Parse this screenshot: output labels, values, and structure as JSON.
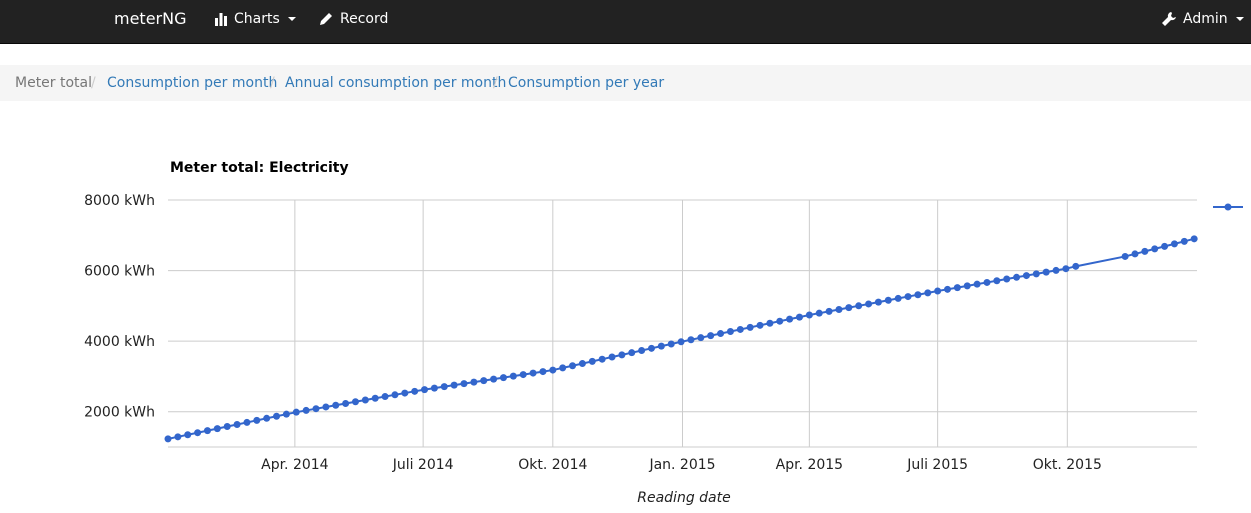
{
  "navbar": {
    "brand": "meterNG",
    "charts_label": "Charts",
    "record_label": "Record",
    "admin_label": "Admin"
  },
  "breadcrumb": {
    "items": [
      "Meter total",
      "Consumption per month",
      "Annual consumption per month",
      "Consumption per year"
    ],
    "separator": "/"
  },
  "colors": {
    "series": "#3366cc",
    "navbar": "#222222",
    "link": "#337ab7"
  },
  "chart_data": {
    "type": "line",
    "title": "Meter total: Electricity",
    "xlabel": "Reading date",
    "ylabel": "",
    "y_unit": "kWh",
    "ylim": [
      1000,
      8000
    ],
    "yticks": [
      2000,
      4000,
      6000,
      8000
    ],
    "ytick_labels": [
      "2000 kWh",
      "4000 kWh",
      "6000 kWh",
      "8000 kWh"
    ],
    "xlim": [
      "2014-01-01",
      "2016-01-01"
    ],
    "xticks": [
      "2014-04-01",
      "2014-07-01",
      "2014-10-01",
      "2015-01-01",
      "2015-04-01",
      "2015-07-01",
      "2015-10-01"
    ],
    "xtick_labels": [
      "Apr. 2014",
      "Juli 2014",
      "Okt. 2014",
      "Jan. 2015",
      "Apr. 2015",
      "Juli 2015",
      "Okt. 2015"
    ],
    "grid": true,
    "legend": "right",
    "series": [
      {
        "x": [
          "2014-01-01",
          "2014-04-01",
          "2014-07-01",
          "2014-10-01",
          "2015-01-01",
          "2015-04-01",
          "2015-07-01",
          "2015-10-01",
          "2015-10-08",
          "2015-11-08",
          "2016-01-01"
        ],
        "y": [
          1230,
          1980,
          2620,
          3180,
          3990,
          4740,
          5420,
          6060,
          6130,
          6370,
          6920
        ],
        "points_per_week": true
      }
    ]
  }
}
